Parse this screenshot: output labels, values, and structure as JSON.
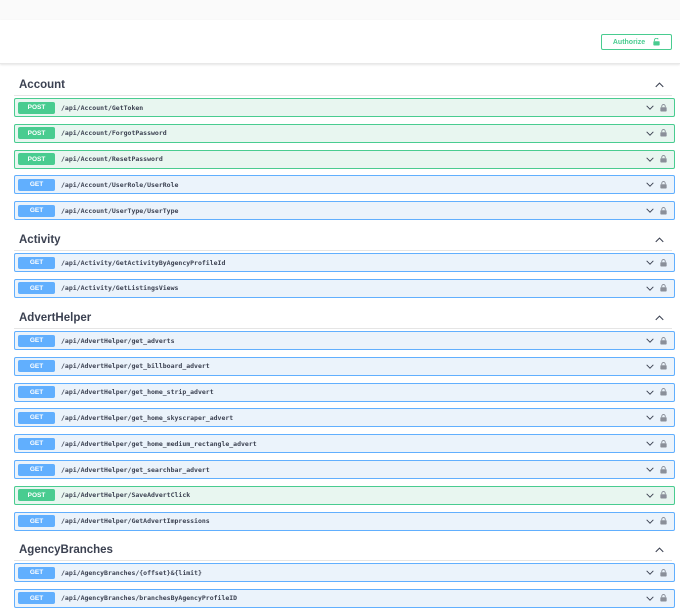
{
  "authorize_label": "Authorize",
  "colors": {
    "get": "#61affe",
    "post": "#49cc90",
    "get_bg": "#ebf3fb",
    "post_bg": "#e8f6f0"
  },
  "tags": [
    {
      "name": "Account",
      "operations": [
        {
          "method": "POST",
          "path": "/api/Account/GetToken"
        },
        {
          "method": "POST",
          "path": "/api/Account/ForgotPassword"
        },
        {
          "method": "POST",
          "path": "/api/Account/ResetPassword"
        },
        {
          "method": "GET",
          "path": "/api/Account/UserRole/UserRole"
        },
        {
          "method": "GET",
          "path": "/api/Account/UserType/UserType"
        }
      ]
    },
    {
      "name": "Activity",
      "operations": [
        {
          "method": "GET",
          "path": "/api/Activity/GetActivityByAgencyProfileId"
        },
        {
          "method": "GET",
          "path": "/api/Activity/GetListingsViews"
        }
      ]
    },
    {
      "name": "AdvertHelper",
      "operations": [
        {
          "method": "GET",
          "path": "/api/AdvertHelper/get_adverts"
        },
        {
          "method": "GET",
          "path": "/api/AdvertHelper/get_billboard_advert"
        },
        {
          "method": "GET",
          "path": "/api/AdvertHelper/get_home_strip_advert"
        },
        {
          "method": "GET",
          "path": "/api/AdvertHelper/get_home_skyscraper_advert"
        },
        {
          "method": "GET",
          "path": "/api/AdvertHelper/get_home_medium_rectangle_advert"
        },
        {
          "method": "GET",
          "path": "/api/AdvertHelper/get_searchbar_advert"
        },
        {
          "method": "POST",
          "path": "/api/AdvertHelper/SaveAdvertClick"
        },
        {
          "method": "GET",
          "path": "/api/AdvertHelper/GetAdvertImpressions"
        }
      ]
    },
    {
      "name": "AgencyBranches",
      "operations": [
        {
          "method": "GET",
          "path": "/api/AgencyBranches/{offset}&{limit}"
        },
        {
          "method": "GET",
          "path": "/api/AgencyBranches/branchesByAgencyProfileID"
        }
      ]
    }
  ]
}
